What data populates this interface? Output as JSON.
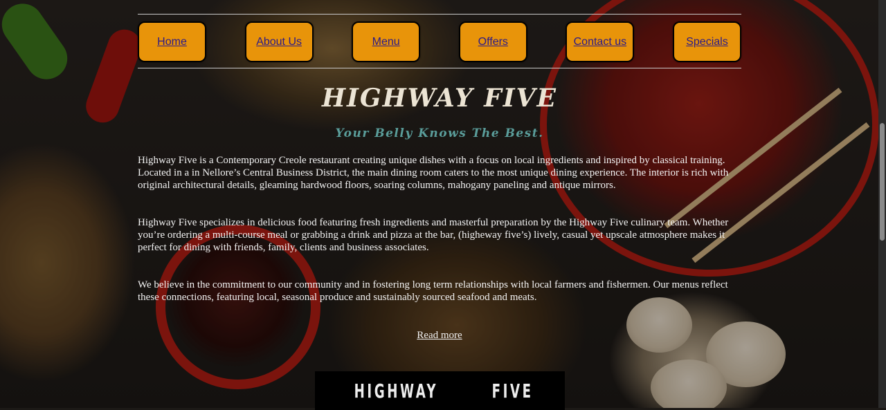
{
  "nav": {
    "items": [
      "Home",
      "About Us",
      "Menu",
      "Offers",
      "Contact us",
      "Specials"
    ]
  },
  "hero": {
    "title": "HIGHWAY FIVE",
    "tagline": "Your Belly Knows The Best."
  },
  "about": {
    "paragraph_1": "Highway Five is a Contemporary Creole restaurant creating unique dishes with a focus on local ingredients and inspired by classical training. Located in a in Nellore’s Central Business District, the main dining room caters to the most unique dining experience. The interior is rich with original architectural details, gleaming hardwood floors, soaring columns, mahogany paneling and antique mirrors.",
    "paragraph_2": "Highway Five specializes in delicious food featuring fresh ingredients and masterful preparation by the Highway Five culinary team. Whether you’re ordering a multi-course meal or grabbing a drink and pizza at the bar, (higheway five’s) lively, casual yet upscale atmosphere makes it perfect for dining with friends, family, clients and business associates.",
    "paragraph_3": "We believe in the commitment to our community and in fostering long term relationships with local farmers and fishermen. Our menus reflect these connections, featuring local, seasonal produce and sustainably sourced seafood and meats.",
    "read_more": "Read more"
  },
  "logo": {
    "word_1": "HIGHWAY",
    "word_2": "FIVE"
  },
  "colors": {
    "nav_button": "#e8940a",
    "nav_link": "#2a1a8a",
    "title": "#ece4d4",
    "tagline": "#5a9d9a"
  }
}
